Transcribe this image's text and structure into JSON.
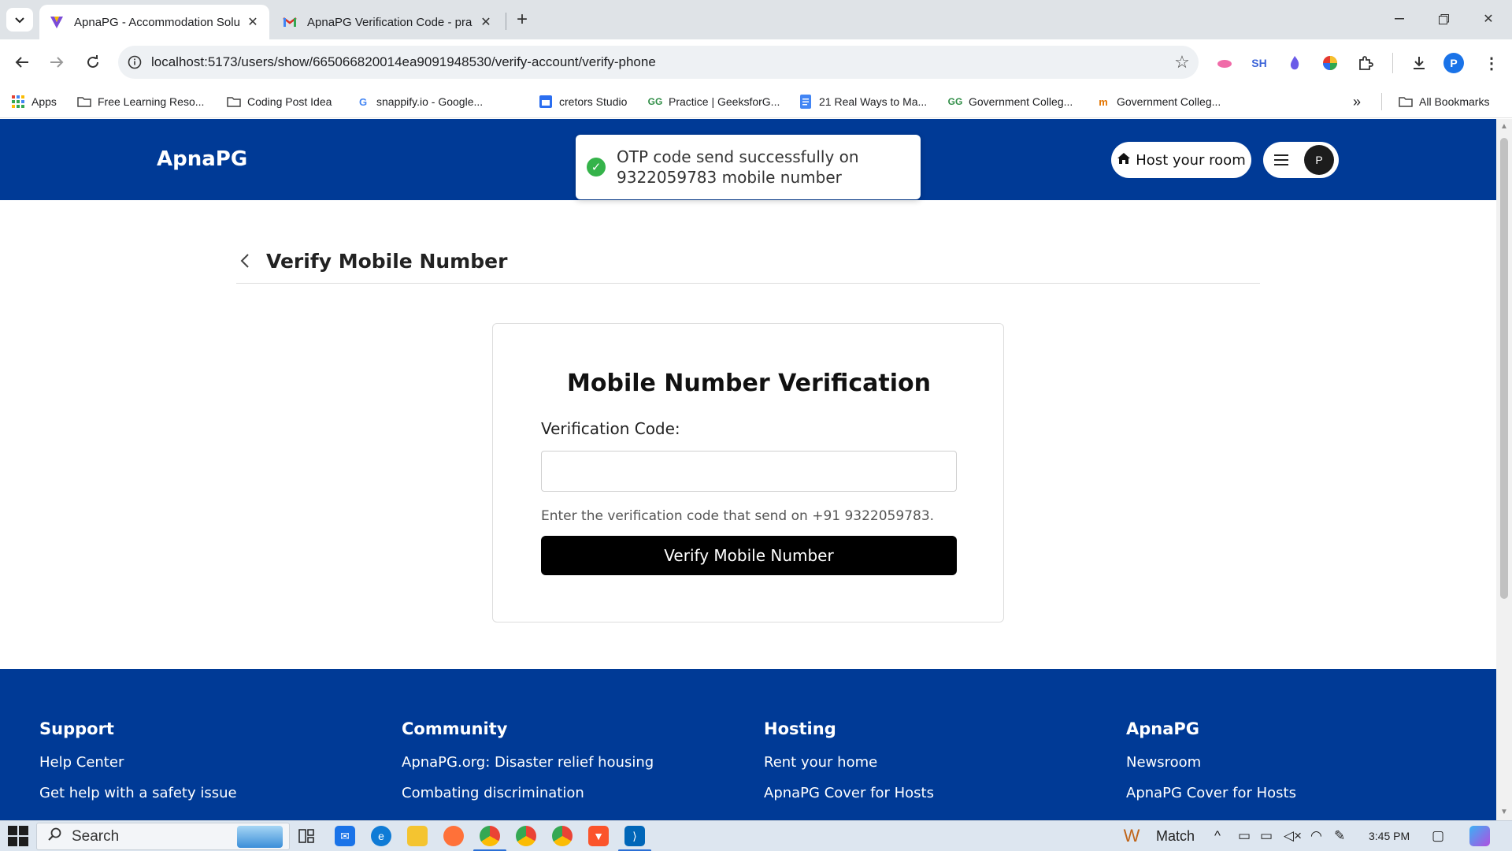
{
  "browser": {
    "tabs": [
      {
        "title": "ApnaPG - Accommodation Solu",
        "active": true
      },
      {
        "title": "ApnaPG Verification Code - pra",
        "active": false
      }
    ],
    "url": "localhost:5173/users/show/665066820014ea9091948530/verify-account/verify-phone",
    "extensions": [
      "SH"
    ],
    "profile_initial": "P",
    "bookmarks": [
      {
        "label": "Apps",
        "icon": "apps-grid-icon"
      },
      {
        "label": "Free Learning Reso...",
        "icon": "folder-icon"
      },
      {
        "label": "Coding Post Idea",
        "icon": "folder-icon"
      },
      {
        "label": "snappify.io - Google...",
        "icon": "google-icon"
      },
      {
        "label": "cretors Studio",
        "icon": "studio-icon"
      },
      {
        "label": "Practice | GeeksforG...",
        "icon": "geeksforgeeks-icon"
      },
      {
        "label": "21 Real Ways to Ma...",
        "icon": "docs-icon"
      },
      {
        "label": "Government Colleg...",
        "icon": "geeksforgeeks-icon"
      },
      {
        "label": "Government Colleg...",
        "icon": "site-icon"
      }
    ],
    "all_bookmarks": "All Bookmarks"
  },
  "header": {
    "logo": "ApnaPG",
    "host_button": "Host your room",
    "avatar_initial": "P"
  },
  "toast": {
    "message_line1": "OTP code send successfully on",
    "message_line2": "9322059783 mobile number"
  },
  "page": {
    "heading": "Verify Mobile Number"
  },
  "card": {
    "title": "Mobile Number Verification",
    "label": "Verification Code:",
    "input_value": "",
    "helper": "Enter the verification code that send on +91 9322059783.",
    "button": "Verify Mobile Number"
  },
  "footer": {
    "columns": [
      {
        "title": "Support",
        "links": [
          "Help Center",
          "Get help with a safety issue"
        ]
      },
      {
        "title": "Community",
        "links": [
          "ApnaPG.org: Disaster relief housing",
          "Combating discrimination"
        ]
      },
      {
        "title": "Hosting",
        "links": [
          "Rent your home",
          "ApnaPG Cover for Hosts"
        ]
      },
      {
        "title": "ApnaPG",
        "links": [
          "Newsroom",
          "ApnaPG Cover for Hosts"
        ]
      }
    ]
  },
  "taskbar": {
    "search": "Search",
    "weather_label": "Match",
    "time": "3:45 PM"
  },
  "colors": {
    "brand_blue": "#003a96",
    "button_black": "#000000",
    "success_green": "#35b34a"
  }
}
